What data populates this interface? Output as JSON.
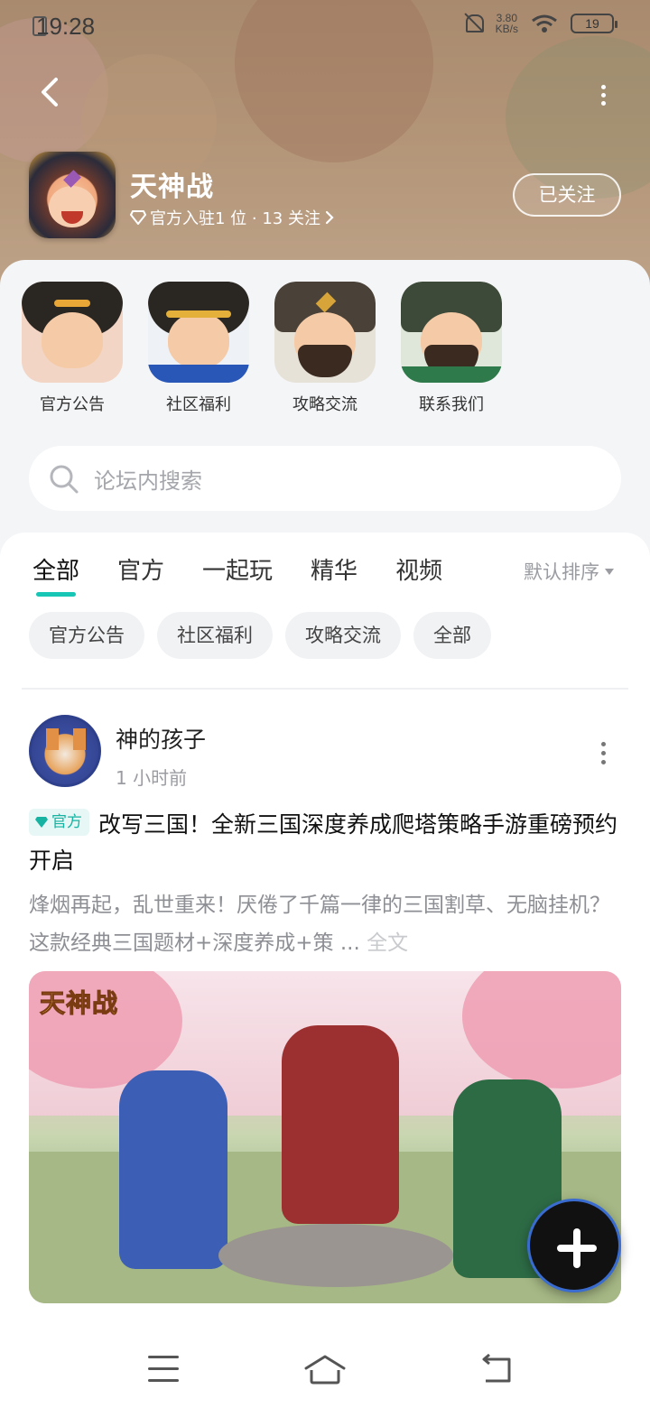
{
  "status_bar": {
    "time": "19:28",
    "net_speed": "3.80",
    "net_unit": "KB/s",
    "battery": "19"
  },
  "header": {
    "app_name": "天神战",
    "subtitle": "官方入驻1 位 · 13 关注",
    "follow_label": "已关注"
  },
  "shortcuts": [
    {
      "label": "官方公告",
      "icon": "character-avatar-crying"
    },
    {
      "label": "社区福利",
      "icon": "character-avatar-headband"
    },
    {
      "label": "攻略交流",
      "icon": "character-avatar-helmet"
    },
    {
      "label": "联系我们",
      "icon": "character-avatar-green-general"
    }
  ],
  "search": {
    "placeholder": "论坛内搜索"
  },
  "tabs": [
    {
      "label": "全部",
      "active": true
    },
    {
      "label": "官方"
    },
    {
      "label": "一起玩"
    },
    {
      "label": "精华"
    },
    {
      "label": "视频"
    }
  ],
  "sort_label": "默认排序",
  "chips": [
    "官方公告",
    "社区福利",
    "攻略交流",
    "全部"
  ],
  "post": {
    "author": "神的孩子",
    "time": "1 小时前",
    "badge": "官方",
    "title": "改写三国！全新三国深度养成爬塔策略手游重磅预约开启",
    "body": "烽烟再起，乱世重来！厌倦了千篇一律的三国割草、无脑挂机？这款经典三国题材+深度养成+策 ...",
    "full_text": "全文",
    "image_logo": "天神战"
  },
  "colors": {
    "accent": "#17c6b5",
    "badge_bg": "#e6f7f5"
  }
}
